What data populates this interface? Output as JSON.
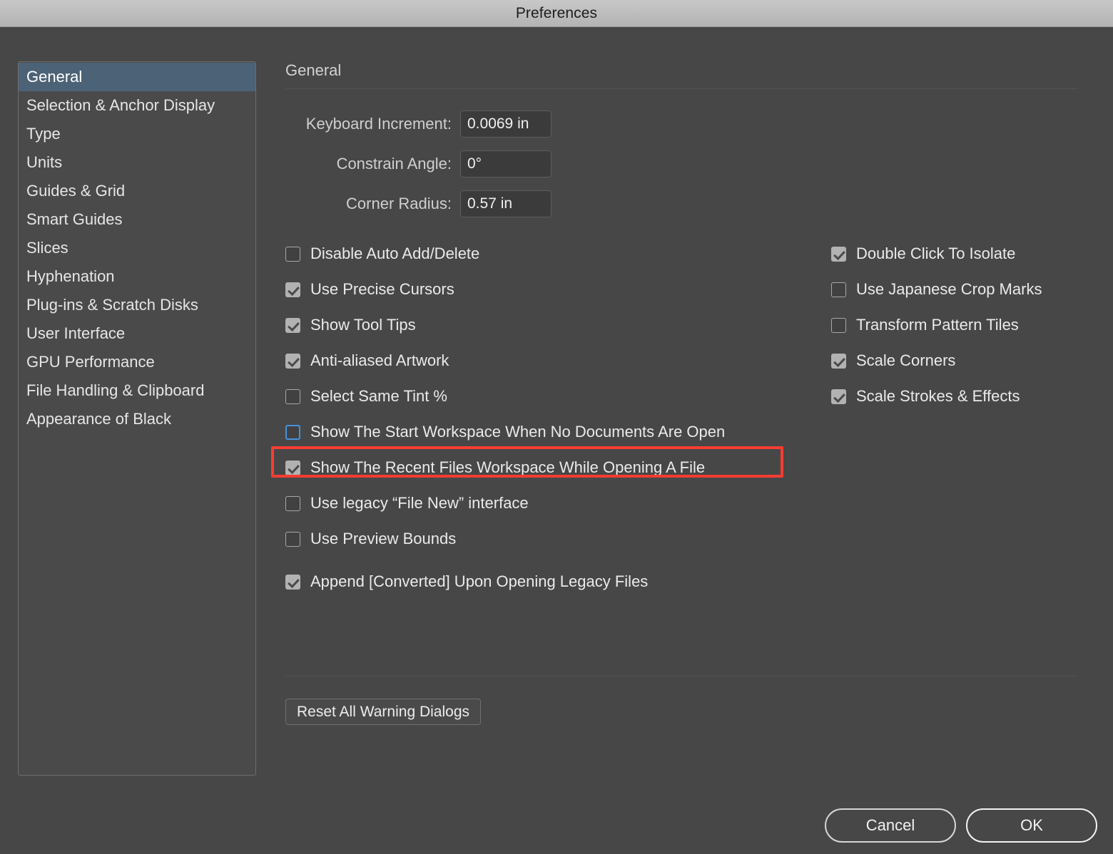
{
  "window": {
    "title": "Preferences"
  },
  "sidebar": {
    "items": [
      {
        "label": "General",
        "selected": true
      },
      {
        "label": "Selection & Anchor Display",
        "selected": false
      },
      {
        "label": "Type",
        "selected": false
      },
      {
        "label": "Units",
        "selected": false
      },
      {
        "label": "Guides & Grid",
        "selected": false
      },
      {
        "label": "Smart Guides",
        "selected": false
      },
      {
        "label": "Slices",
        "selected": false
      },
      {
        "label": "Hyphenation",
        "selected": false
      },
      {
        "label": "Plug-ins & Scratch Disks",
        "selected": false
      },
      {
        "label": "User Interface",
        "selected": false
      },
      {
        "label": "GPU Performance",
        "selected": false
      },
      {
        "label": "File Handling & Clipboard",
        "selected": false
      },
      {
        "label": "Appearance of Black",
        "selected": false
      }
    ]
  },
  "panel": {
    "title": "General",
    "fields": [
      {
        "label": "Keyboard Increment:",
        "value": "0.0069 in"
      },
      {
        "label": "Constrain Angle:",
        "value": "0°"
      },
      {
        "label": "Corner Radius:",
        "value": "0.57 in"
      }
    ],
    "checkboxes_left": [
      {
        "label": "Disable Auto Add/Delete",
        "checked": false,
        "state": "normal"
      },
      {
        "label": "Use Precise Cursors",
        "checked": true,
        "state": "normal"
      },
      {
        "label": "Show Tool Tips",
        "checked": true,
        "state": "normal"
      },
      {
        "label": "Anti-aliased Artwork",
        "checked": true,
        "state": "normal"
      },
      {
        "label": "Select Same Tint %",
        "checked": false,
        "state": "normal"
      },
      {
        "label": "Show The Start Workspace When No Documents Are Open",
        "checked": false,
        "state": "focused"
      },
      {
        "label": "Show The Recent Files Workspace While Opening A File",
        "checked": true,
        "state": "highlighted"
      },
      {
        "label": "Use legacy “File New” interface",
        "checked": false,
        "state": "normal"
      },
      {
        "label": "Use Preview Bounds",
        "checked": false,
        "state": "normal"
      },
      {
        "label": "Append [Converted] Upon Opening Legacy Files",
        "checked": true,
        "state": "normal"
      }
    ],
    "checkboxes_right": [
      {
        "label": "Double Click To Isolate",
        "checked": true,
        "state": "normal"
      },
      {
        "label": "Use Japanese Crop Marks",
        "checked": false,
        "state": "normal"
      },
      {
        "label": "Transform Pattern Tiles",
        "checked": false,
        "state": "normal"
      },
      {
        "label": "Scale Corners",
        "checked": true,
        "state": "normal"
      },
      {
        "label": "Scale Strokes & Effects",
        "checked": true,
        "state": "normal"
      }
    ],
    "reset_button": "Reset All Warning Dialogs"
  },
  "footer": {
    "cancel_label": "Cancel",
    "ok_label": "OK"
  },
  "colors": {
    "dialog_background": "#474747",
    "titlebar_background": "#bcbcbc",
    "selection_blue": "#4c6276",
    "highlight_red": "#fa3c32",
    "focus_blue": "#4a90d9",
    "checkbox_checked": "#b2b2b2"
  }
}
